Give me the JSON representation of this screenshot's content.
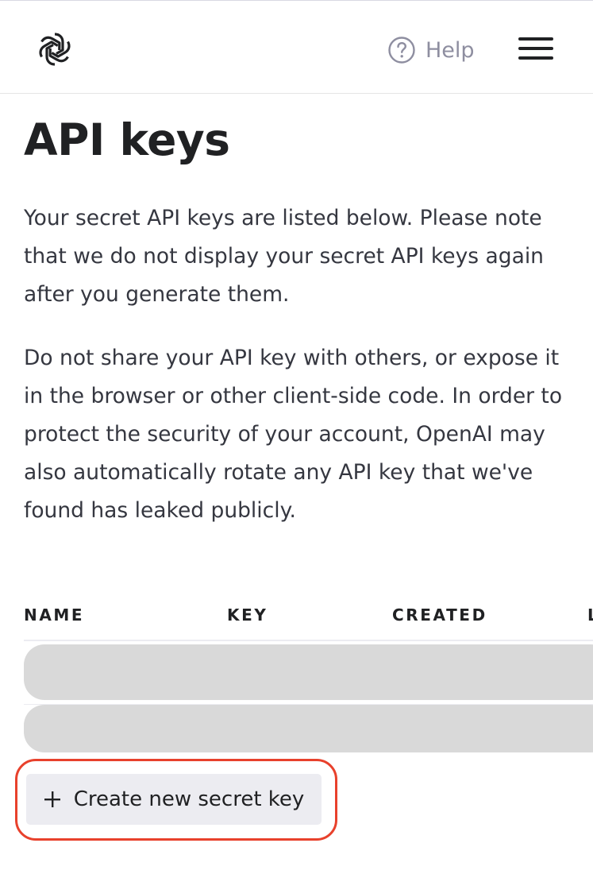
{
  "header": {
    "logo_name": "openai-logo",
    "help_label": "Help"
  },
  "main": {
    "title": "API keys",
    "paragraphs": [
      "Your secret API keys are listed below. Please note that we do not display your secret API keys again after you generate them.",
      "Do not share your API key with others, or expose it in the browser or other client-side code. In order to protect the security of your account, OpenAI may also automatically rotate any API key that we've found has leaked publicly."
    ],
    "table": {
      "columns": [
        "NAME",
        "KEY",
        "CREATED",
        "L"
      ],
      "rows_loading": 2
    },
    "create_button_label": "Create new secret key"
  },
  "colors": {
    "highlight": "#e8412c",
    "button_bg": "#ececf1",
    "skeleton": "#d9d9d9"
  }
}
